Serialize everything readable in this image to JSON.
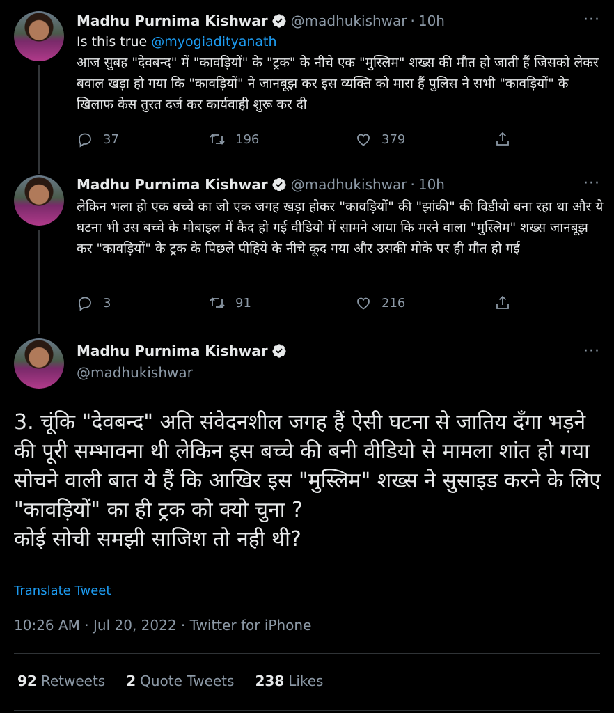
{
  "tweet1": {
    "name": "Madhu Purnima Kishwar",
    "handle": "@madhukishwar",
    "time": "10h",
    "line1_prefix": "Is this true ",
    "mention": "@myogiadityanath",
    "text": "आज सुबह \"देवबन्द\" में \"कावड़ियों\" के \"ट्रक\" के नीचे एक \"मुस्लिम\" शख्स की मौत हो जाती हैं जिसको लेकर बवाल खड़ा हो गया कि \"कावड़ियों\" ने जानबूझ कर इस व्यक्ति को मारा हैं पुलिस ने सभी \"कावड़ियों\" के खिलाफ केस तुरत दर्ज कर कार्यवाही शुरू कर दी",
    "replies": "37",
    "retweets": "196",
    "likes": "379"
  },
  "tweet2": {
    "name": "Madhu Purnima Kishwar",
    "handle": "@madhukishwar",
    "time": "10h",
    "text": "लेकिन भला हो एक बच्चे का जो एक जगह खड़ा होकर \"कावड़ियों\" की \"झांकी\" की विडीयो बना रहा था और ये घटना भी उस बच्चे के मोबाइल में कैद हो गई  वीडियो में सामने आया कि मरने वाला \"मुस्लिम\" शख्स जानबूझ कर \"कावड़ियों\" के ट्रक के पिछले पीहिये के नीचे कूद गया और उसकी मोके पर ही मौत हो गई",
    "replies": "3",
    "retweets": "91",
    "likes": "216"
  },
  "main": {
    "name": "Madhu Purnima Kishwar",
    "handle": "@madhukishwar",
    "text": "3. चूंकि \"देवबन्द\" अति संवेदनशील जगह हैं ऐसी घटना से जातिय दँगा भड़ने की पूरी सम्भावना थी लेकिन इस बच्चे की बनी वीडियो से मामला शांत हो गया\nसोचने वाली बात ये हैं कि आखिर इस \"मुस्लिम\" शख्स ने सुसाइड करने के लिए \"कावड़ियों\" का ही ट्रक को क्यो चुना ?\nकोई सोची समझी साजिश तो नही थी?",
    "translate": "Translate Tweet",
    "meta": "10:26 AM · Jul 20, 2022 · Twitter for iPhone",
    "retweets_count": "92",
    "retweets_label": "Retweets",
    "quotes_count": "2",
    "quotes_label": "Quote Tweets",
    "likes_count": "238",
    "likes_label": "Likes"
  },
  "icons": {
    "more": "more-icon",
    "reply": "reply-icon",
    "retweet": "retweet-icon",
    "like": "like-icon",
    "share": "share-icon",
    "verified": "verified-badge-icon"
  },
  "colors": {
    "background": "#000000",
    "text": "#e7e9ea",
    "muted": "#8b98a5",
    "link": "#1d9bf0"
  }
}
